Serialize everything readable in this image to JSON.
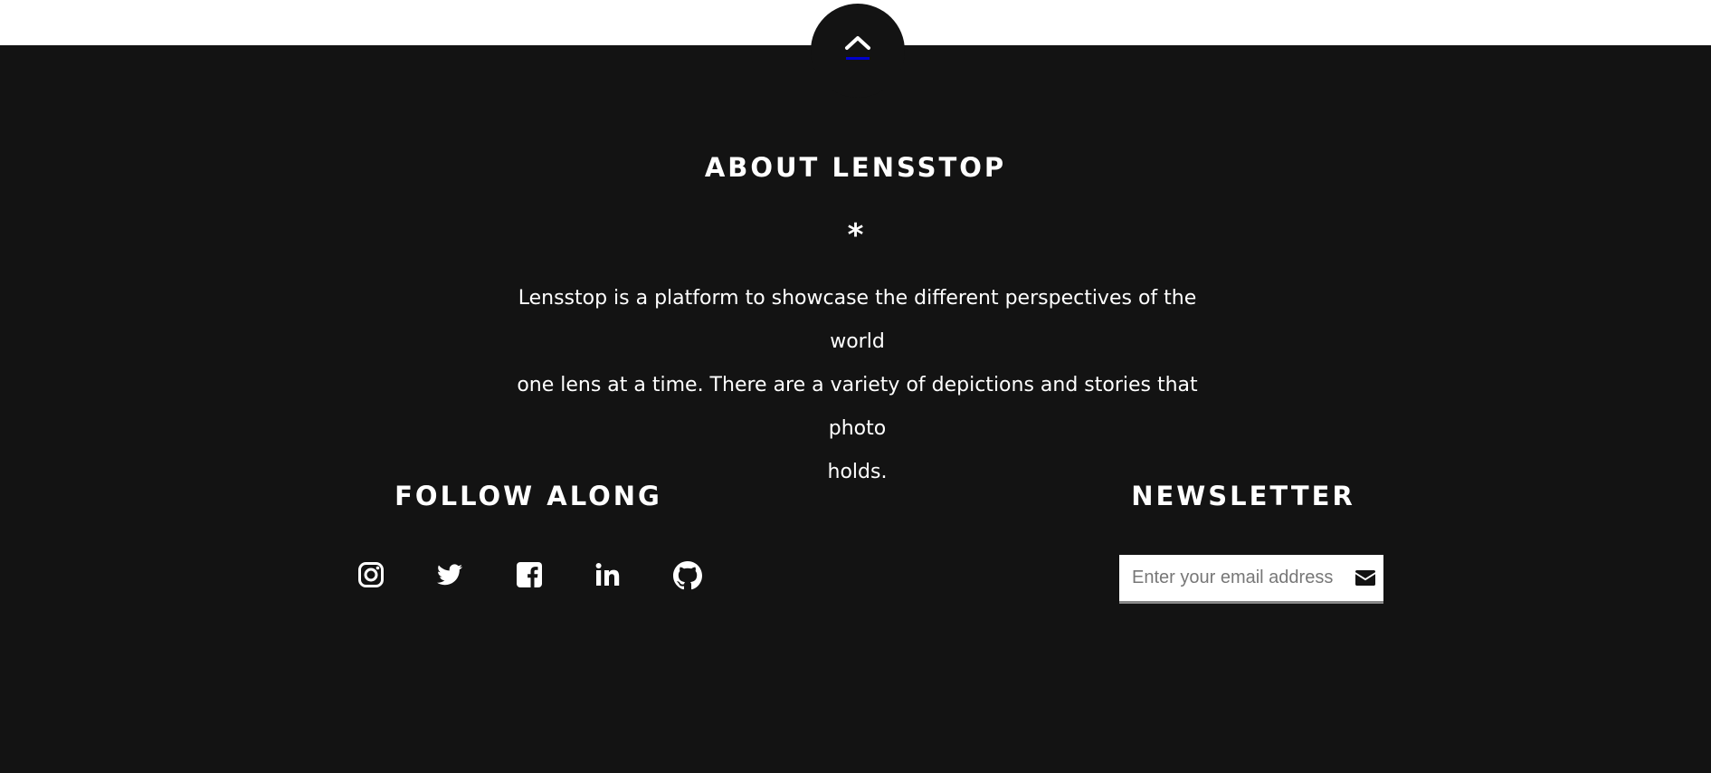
{
  "scroll_top": {
    "icon": "chevron-up-icon"
  },
  "about": {
    "title": "ABOUT LENSSTOP",
    "divider": "*",
    "lines": [
      "Lensstop is a platform to showcase the different perspectives of the world",
      "one lens at a time. There are a variety of depictions and stories that photo",
      "holds."
    ]
  },
  "follow": {
    "title": "FOLLOW ALONG",
    "icons": [
      "instagram-icon",
      "twitter-icon",
      "facebook-icon",
      "linkedin-icon",
      "github-icon"
    ]
  },
  "newsletter": {
    "title": "NEWSLETTER",
    "placeholder": "Enter your email address",
    "value": "",
    "submit_icon": "envelope-icon"
  },
  "colors": {
    "footer_bg": "#131313",
    "text": "#ffffff",
    "link_underline": "#0000cc"
  }
}
